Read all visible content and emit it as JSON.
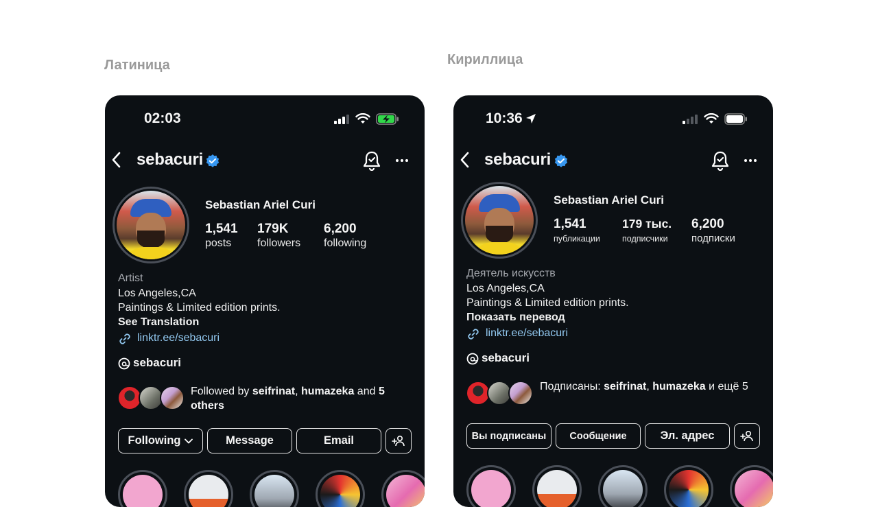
{
  "captions": {
    "latin": "Латиница",
    "cyrillic": "Кириллица"
  },
  "colors": {
    "background": "#0c1014",
    "text": "#f5f5f5",
    "link": "#92c8f0",
    "verified": "#3797f0",
    "battery_charging": "#32d74b"
  },
  "left": {
    "time": "02:03",
    "username": "sebacuri",
    "full_name": "Sebastian Ariel Curi",
    "stats": [
      {
        "value": "1,541",
        "label": "posts"
      },
      {
        "value": "179K",
        "label": "followers"
      },
      {
        "value": "6,200",
        "label": "following"
      }
    ],
    "category": "Artist",
    "bio_line1": "Los Angeles,CA",
    "bio_line2": "Paintings & Limited edition prints.",
    "see_translation": "See Translation",
    "link": "linktr.ee/sebacuri",
    "threads": "sebacuri",
    "followed_prefix": "Followed by ",
    "followed_user1": "seifrinat",
    "followed_sep": ", ",
    "followed_user2": "humazeka",
    "followed_and": " and ",
    "followed_others": "5 others",
    "buttons": {
      "following": "Following",
      "message": "Message",
      "email": "Email"
    }
  },
  "right": {
    "time": "10:36",
    "username": "sebacuri",
    "full_name": "Sebastian Ariel Curi",
    "stats": [
      {
        "value": "1,541",
        "label": "публикации"
      },
      {
        "value": "179 тыс.",
        "label": "подписчики"
      },
      {
        "value": "6,200",
        "label": "подписки"
      }
    ],
    "category": "Деятель искусств",
    "bio_line1": "Los Angeles,CA",
    "bio_line2": "Paintings & Limited edition prints.",
    "see_translation": "Показать перевод",
    "link": "linktr.ee/sebacuri",
    "threads": "sebacuri",
    "followed_prefix": "Подписаны: ",
    "followed_user1": "seifrinat",
    "followed_sep": ", ",
    "followed_user2": "humazeka",
    "followed_and": " и ещё",
    "followed_others": "5",
    "buttons": {
      "following": "Вы подписаны",
      "message": "Сообщение",
      "email": "Эл. адрес"
    }
  }
}
